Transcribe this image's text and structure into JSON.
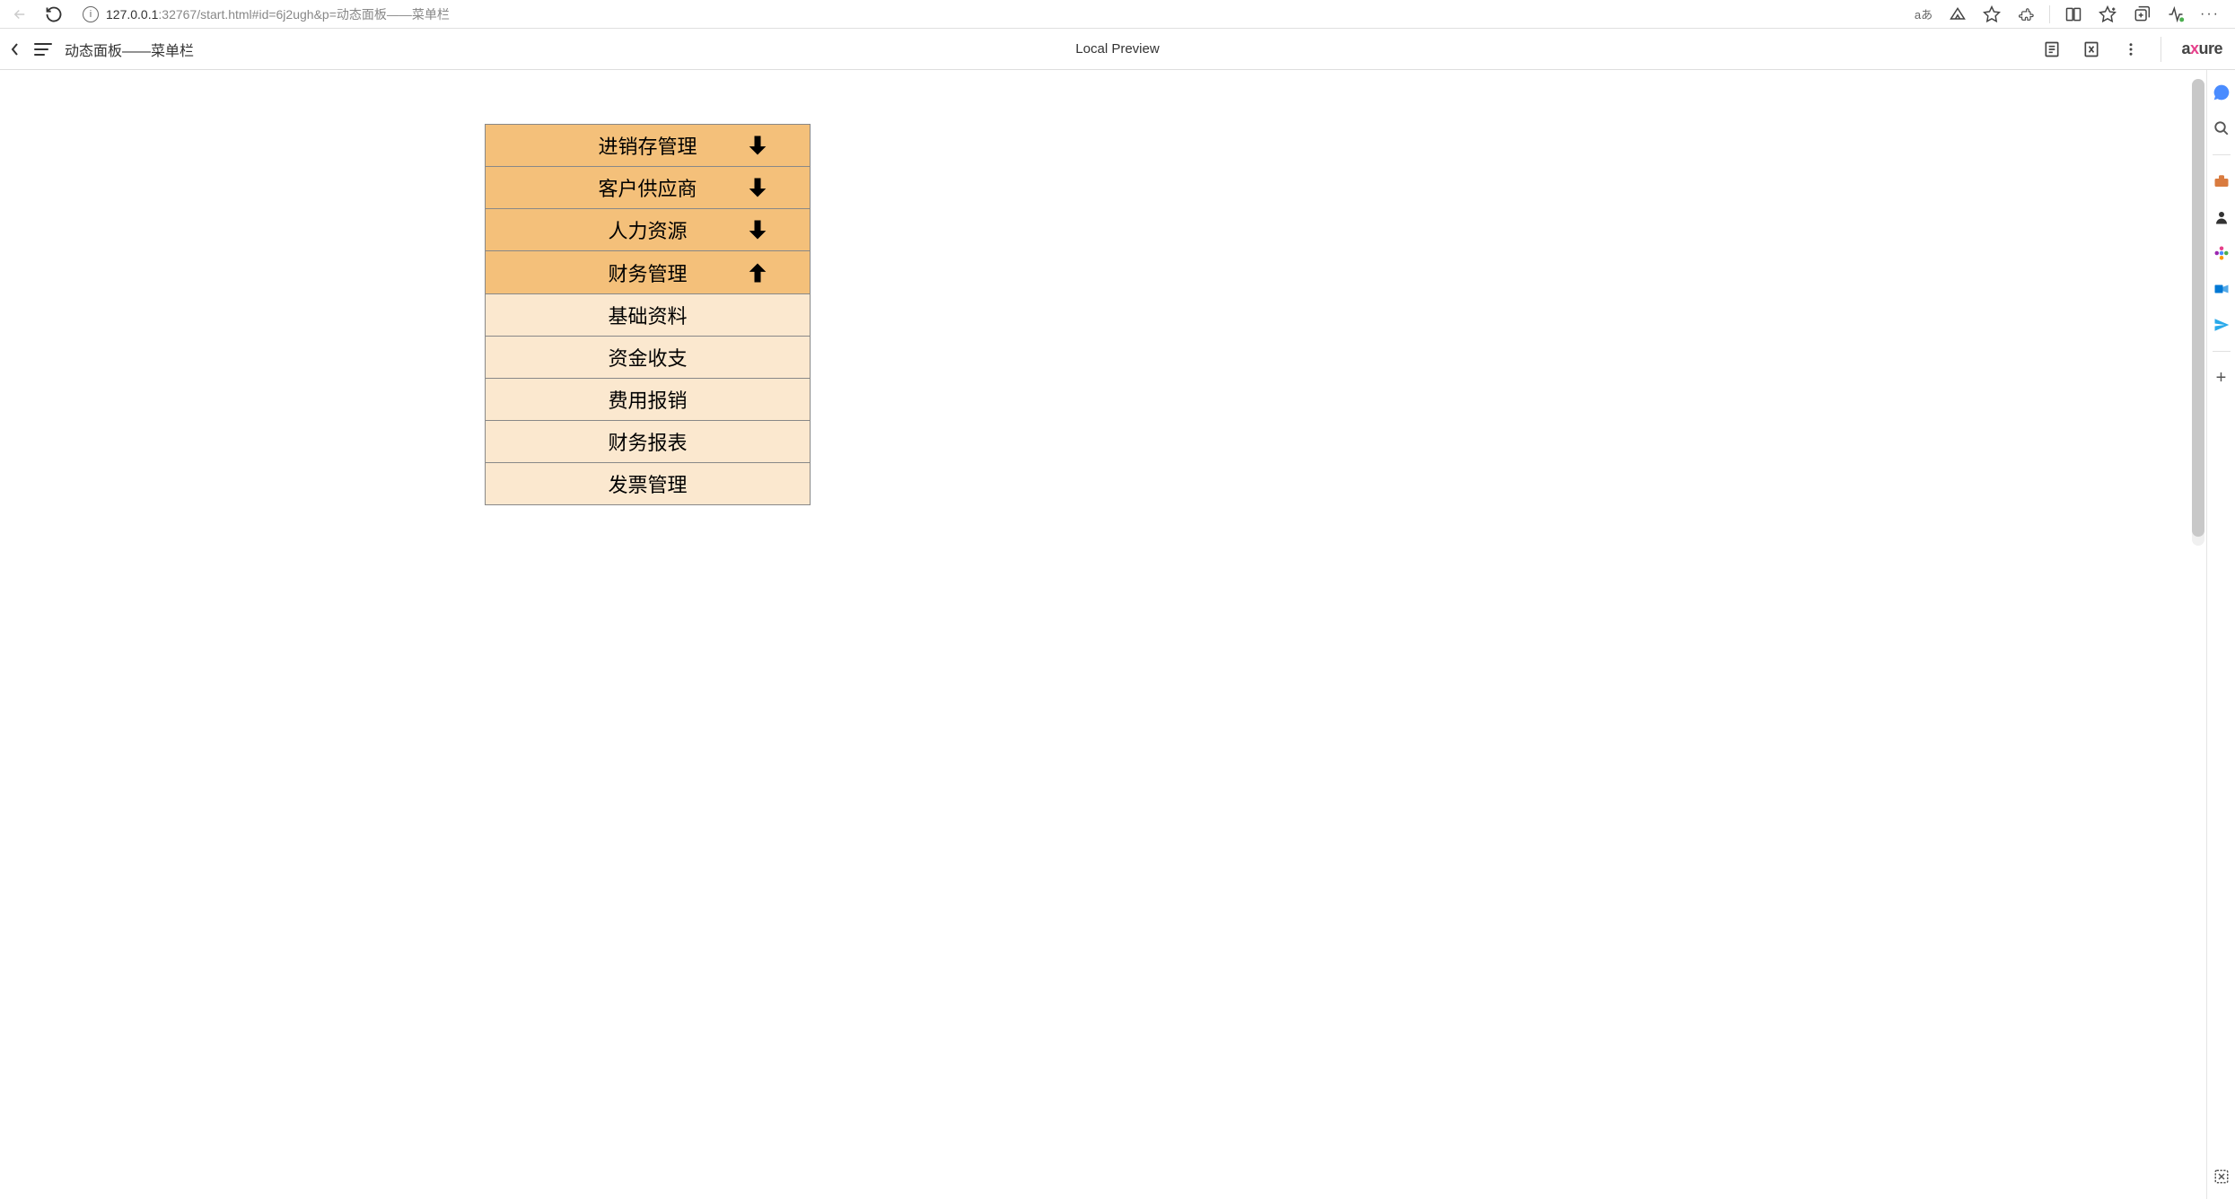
{
  "browser": {
    "url_host": "127.0.0.1",
    "url_rest": ":32767/start.html#id=6j2ugh&p=动态面板——菜单栏",
    "lang_badge": "aあ"
  },
  "axure": {
    "page_title": "动态面板——菜单栏",
    "center_label": "Local Preview",
    "logo_pre": "a",
    "logo_x": "x",
    "logo_post": "ure"
  },
  "menu": {
    "headers": [
      {
        "label": "进销存管理",
        "expanded": false
      },
      {
        "label": "客户供应商",
        "expanded": false
      },
      {
        "label": "人力资源",
        "expanded": false
      },
      {
        "label": "财务管理",
        "expanded": true
      }
    ],
    "subs": [
      "基础资料",
      "资金收支",
      "费用报销",
      "财务报表",
      "发票管理"
    ]
  }
}
